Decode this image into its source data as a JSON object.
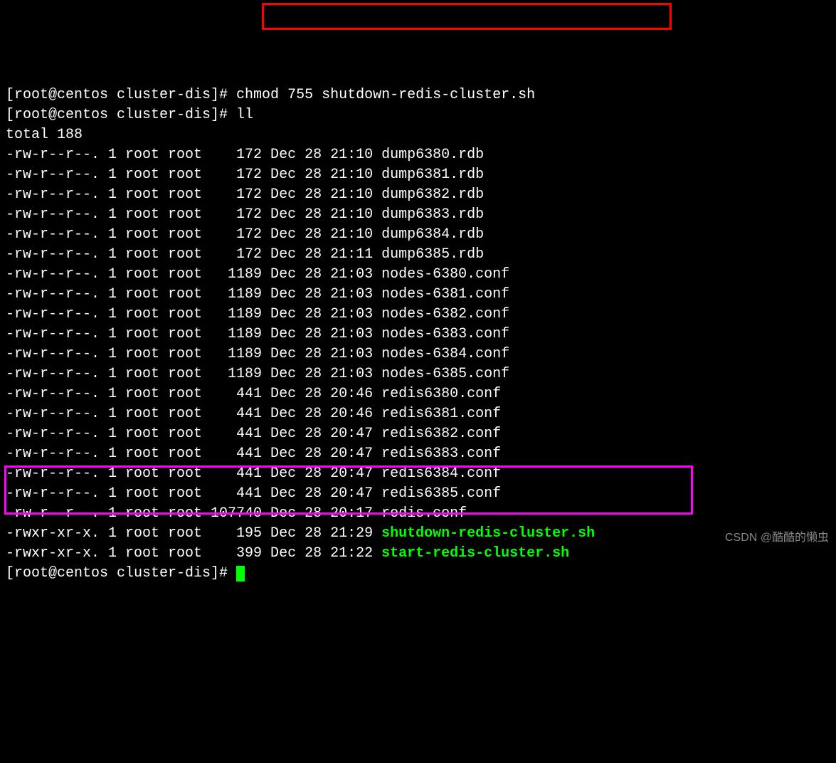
{
  "prompt": "[root@centos cluster-dis]# ",
  "cmd1": "chmod 755 shutdown-redis-cluster.sh",
  "cmd2": "ll",
  "total": "total 188",
  "rows": [
    {
      "perm": "-rw-r--r--.",
      "links": "1",
      "owner": "root",
      "group": "root",
      "size": "   172",
      "month": "Dec",
      "day": "28",
      "time": "21:10",
      "name": "dump6380.rdb",
      "exec": false
    },
    {
      "perm": "-rw-r--r--.",
      "links": "1",
      "owner": "root",
      "group": "root",
      "size": "   172",
      "month": "Dec",
      "day": "28",
      "time": "21:10",
      "name": "dump6381.rdb",
      "exec": false
    },
    {
      "perm": "-rw-r--r--.",
      "links": "1",
      "owner": "root",
      "group": "root",
      "size": "   172",
      "month": "Dec",
      "day": "28",
      "time": "21:10",
      "name": "dump6382.rdb",
      "exec": false
    },
    {
      "perm": "-rw-r--r--.",
      "links": "1",
      "owner": "root",
      "group": "root",
      "size": "   172",
      "month": "Dec",
      "day": "28",
      "time": "21:10",
      "name": "dump6383.rdb",
      "exec": false
    },
    {
      "perm": "-rw-r--r--.",
      "links": "1",
      "owner": "root",
      "group": "root",
      "size": "   172",
      "month": "Dec",
      "day": "28",
      "time": "21:10",
      "name": "dump6384.rdb",
      "exec": false
    },
    {
      "perm": "-rw-r--r--.",
      "links": "1",
      "owner": "root",
      "group": "root",
      "size": "   172",
      "month": "Dec",
      "day": "28",
      "time": "21:11",
      "name": "dump6385.rdb",
      "exec": false
    },
    {
      "perm": "-rw-r--r--.",
      "links": "1",
      "owner": "root",
      "group": "root",
      "size": "  1189",
      "month": "Dec",
      "day": "28",
      "time": "21:03",
      "name": "nodes-6380.conf",
      "exec": false
    },
    {
      "perm": "-rw-r--r--.",
      "links": "1",
      "owner": "root",
      "group": "root",
      "size": "  1189",
      "month": "Dec",
      "day": "28",
      "time": "21:03",
      "name": "nodes-6381.conf",
      "exec": false
    },
    {
      "perm": "-rw-r--r--.",
      "links": "1",
      "owner": "root",
      "group": "root",
      "size": "  1189",
      "month": "Dec",
      "day": "28",
      "time": "21:03",
      "name": "nodes-6382.conf",
      "exec": false
    },
    {
      "perm": "-rw-r--r--.",
      "links": "1",
      "owner": "root",
      "group": "root",
      "size": "  1189",
      "month": "Dec",
      "day": "28",
      "time": "21:03",
      "name": "nodes-6383.conf",
      "exec": false
    },
    {
      "perm": "-rw-r--r--.",
      "links": "1",
      "owner": "root",
      "group": "root",
      "size": "  1189",
      "month": "Dec",
      "day": "28",
      "time": "21:03",
      "name": "nodes-6384.conf",
      "exec": false
    },
    {
      "perm": "-rw-r--r--.",
      "links": "1",
      "owner": "root",
      "group": "root",
      "size": "  1189",
      "month": "Dec",
      "day": "28",
      "time": "21:03",
      "name": "nodes-6385.conf",
      "exec": false
    },
    {
      "perm": "-rw-r--r--.",
      "links": "1",
      "owner": "root",
      "group": "root",
      "size": "   441",
      "month": "Dec",
      "day": "28",
      "time": "20:46",
      "name": "redis6380.conf",
      "exec": false
    },
    {
      "perm": "-rw-r--r--.",
      "links": "1",
      "owner": "root",
      "group": "root",
      "size": "   441",
      "month": "Dec",
      "day": "28",
      "time": "20:46",
      "name": "redis6381.conf",
      "exec": false
    },
    {
      "perm": "-rw-r--r--.",
      "links": "1",
      "owner": "root",
      "group": "root",
      "size": "   441",
      "month": "Dec",
      "day": "28",
      "time": "20:47",
      "name": "redis6382.conf",
      "exec": false
    },
    {
      "perm": "-rw-r--r--.",
      "links": "1",
      "owner": "root",
      "group": "root",
      "size": "   441",
      "month": "Dec",
      "day": "28",
      "time": "20:47",
      "name": "redis6383.conf",
      "exec": false
    },
    {
      "perm": "-rw-r--r--.",
      "links": "1",
      "owner": "root",
      "group": "root",
      "size": "   441",
      "month": "Dec",
      "day": "28",
      "time": "20:47",
      "name": "redis6384.conf",
      "exec": false
    },
    {
      "perm": "-rw-r--r--.",
      "links": "1",
      "owner": "root",
      "group": "root",
      "size": "   441",
      "month": "Dec",
      "day": "28",
      "time": "20:47",
      "name": "redis6385.conf",
      "exec": false
    },
    {
      "perm": "-rw-r--r--.",
      "links": "1",
      "owner": "root",
      "group": "root",
      "size": "107740",
      "month": "Dec",
      "day": "28",
      "time": "20:17",
      "name": "redis.conf",
      "exec": false
    },
    {
      "perm": "-rwxr-xr-x.",
      "links": "1",
      "owner": "root",
      "group": "root",
      "size": "   195",
      "month": "Dec",
      "day": "28",
      "time": "21:29",
      "name": "shutdown-redis-cluster.sh",
      "exec": true
    },
    {
      "perm": "-rwxr-xr-x.",
      "links": "1",
      "owner": "root",
      "group": "root",
      "size": "   399",
      "month": "Dec",
      "day": "28",
      "time": "21:22",
      "name": "start-redis-cluster.sh",
      "exec": true
    }
  ],
  "watermark": "CSDN @酷酷的懒虫"
}
